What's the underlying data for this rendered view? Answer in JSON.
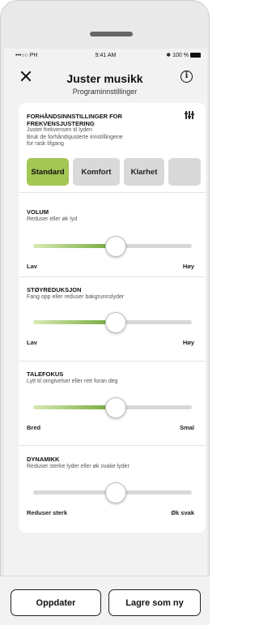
{
  "status_bar": {
    "carrier": "•••○○ PH",
    "time": "9:41 AM",
    "battery": "100 %"
  },
  "header": {
    "title": "Juster musikk",
    "subtitle": "Programinnstillinger"
  },
  "presets": {
    "title": "FORHÅNDSINNSTILLINGER FOR FREKVENSJUSTERING",
    "title_line1": "FORHÅNDSINNSTILLINGER FOR",
    "title_line2": "FREKVENSJUSTERING",
    "desc_line1": "Juster frekvensen til lyden",
    "desc_line2": "Bruk de forhåndsjusterte innstillingene",
    "desc_line3": "for rask tilgang",
    "options": [
      {
        "label": "Standard",
        "selected": true
      },
      {
        "label": "Komfort",
        "selected": false
      },
      {
        "label": "Klarhet",
        "selected": false
      },
      {
        "label": "",
        "selected": false
      }
    ]
  },
  "sliders": [
    {
      "title": "VOLUM",
      "desc": "Reduser eller øk lyd",
      "min_label": "Lav",
      "max_label": "Høy",
      "value": 0.52
    },
    {
      "title": "STØYREDUKSJON",
      "desc": "Fang opp eller reduser bakgrunnslyder",
      "min_label": "Lav",
      "max_label": "Høy",
      "value": 0.52
    },
    {
      "title": "TALEFOKUS",
      "desc": "Lytt til omgivelser eller rett foran deg",
      "min_label": "Bred",
      "max_label": "Smal",
      "value": 0.52
    },
    {
      "title": "DYNAMIKK",
      "desc": "Reduser sterke lyder eller øk svake lyder",
      "min_label": "Reduser sterk",
      "max_label": "Øk svak",
      "value": 0.52
    }
  ],
  "actions": {
    "update": "Oppdater",
    "save_as_new": "Lagre som ny"
  },
  "colors": {
    "accent": "#a3c654",
    "slider_fill_end": "#6fa735"
  }
}
